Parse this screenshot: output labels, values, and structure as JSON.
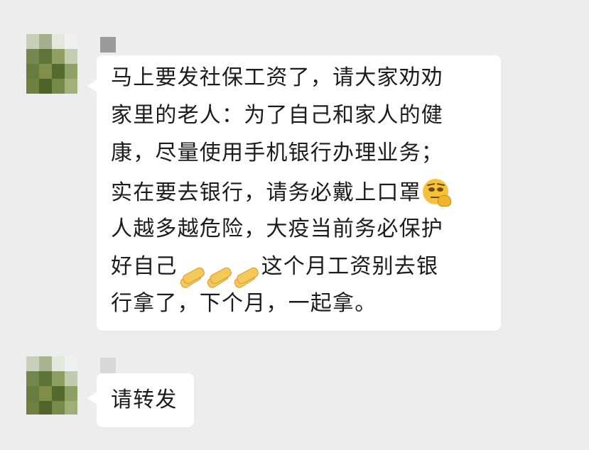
{
  "messages": [
    {
      "lines": [
        [
          "马上要发社保工资了，请大家劝劝"
        ],
        [
          "家里的老人：为了自己和家人的健"
        ],
        [
          "康，尽量使用手机银行办理业务；"
        ],
        [
          "实在要去银行，请务必戴上口罩"
        ],
        [
          "人越多越危险，大疫当前务必保护"
        ],
        [
          "好自己",
          "这个月工资别去银"
        ],
        [
          "行拿了，下个月，一起拿。"
        ]
      ],
      "emojis": {
        "line4_end": "thinking-face-emoji",
        "line6_middle": [
          "folded-hands-emoji",
          "folded-hands-emoji",
          "folded-hands-emoji"
        ]
      }
    },
    {
      "text": "请转发"
    }
  ],
  "colors": {
    "background": "#ededed",
    "bubble": "#ffffff",
    "text": "#1c1c1c"
  }
}
